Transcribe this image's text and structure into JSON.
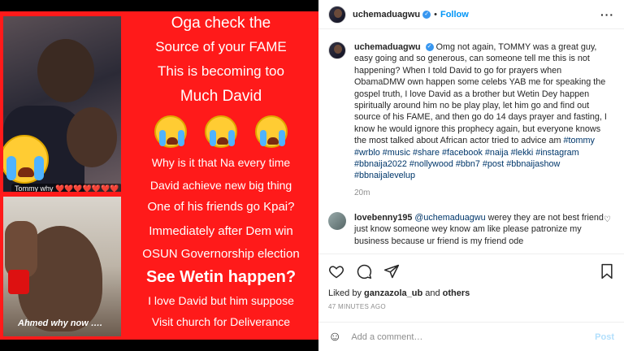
{
  "media": {
    "caption_top": "Tommy why ❤️❤️❤️❤️❤️❤️❤️",
    "caption_bottom": "Ahmed why now ….",
    "poster_lines": [
      "Oga check the",
      "Source of your FAME",
      "This is becoming too",
      "Much David",
      "Why is it that Na every time",
      "David achieve new big thing",
      "One of his friends go Kpai?",
      "Immediately after Dem win",
      "OSUN Governorship election",
      "See Wetin happen?",
      "I love David but him suppose",
      "Visit church for Deliverance"
    ]
  },
  "header": {
    "username": "uchemaduagwu",
    "follow_label": "Follow",
    "more_icon": "more-horizontal-icon"
  },
  "caption": {
    "username": "uchemaduagwu",
    "text": "Omg not again, TOMMY was a great guy, easy going and so generous, can someone tell me this is not happening? When I told David to go for prayers when ObamaDMW own happen some celebs YAB me for speaking the gospel truth, I love David as a brother but Wetin Dey happen spiritually around him no be play play, let him go and find out source of his FAME, and then go do 14 days prayer and fasting, I know he would ignore this prophecy again, but everyone knows the most talked about African actor tried to advice am",
    "hashtags": "#tommy #wrblo #music #share #facebook #naija #lekki #instagram #bbnaija2022 #nollywood #bbn7 #post #bbnaijashow #bbnaijalevelup",
    "time": "20m"
  },
  "comment": {
    "username": "lovebenny195",
    "mention": "@uchemaduagwu",
    "text": "werey they are not best friend just know someone wey know am like please patronize my business because ur friend is my friend ode"
  },
  "actions": {
    "liked_by_prefix": "Liked by",
    "liked_by_user": "ganzazola_ub",
    "liked_by_suffix": "and",
    "others": "others",
    "posted_ago": "47 MINUTES AGO"
  },
  "add_comment": {
    "placeholder": "Add a comment…",
    "post_label": "Post"
  },
  "colors": {
    "poster_red": "#ff1a1a",
    "link_blue": "#0095f6",
    "verified_blue": "#3897f0"
  }
}
